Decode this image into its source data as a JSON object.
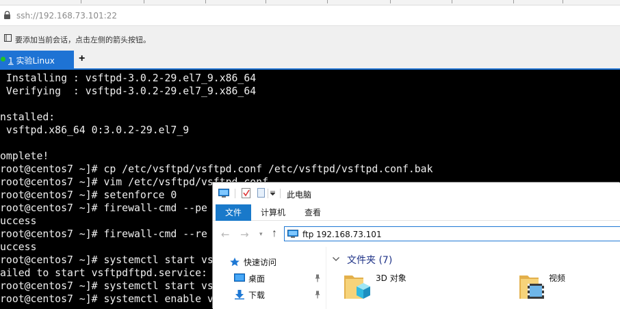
{
  "address_bar": {
    "url": "ssh://192.168.73.101:22"
  },
  "hint_bar": {
    "text": "要添加当前会话，点击左侧的箭头按钮。"
  },
  "tabs": [
    {
      "number": "1",
      "label": "实验Linux"
    }
  ],
  "new_tab_label": "+",
  "terminal": {
    "lines": [
      " Installing : vsftpd-3.0.2-29.el7_9.x86_64",
      " Verifying  : vsftpd-3.0.2-29.el7_9.x86_64",
      "",
      "nstalled:",
      " vsftpd.x86_64 0:3.0.2-29.el7_9",
      "",
      "omplete!",
      "root@centos7 ~]# cp /etc/vsftpd/vsftpd.conf /etc/vsftpd/vsftpd.conf.bak",
      "root@centos7 ~]# vim /etc/vsftpd/vsftpd.conf",
      "root@centos7 ~]# setenforce 0",
      "root@centos7 ~]# firewall-cmd --pe",
      "uccess",
      "root@centos7 ~]# firewall-cmd --re",
      "uccess",
      "root@centos7 ~]# systemctl start vs",
      "ailed to start vsftpdftpd.service:",
      "root@centos7 ~]# systemctl start vs",
      "root@centos7 ~]# systemctl enable v"
    ]
  },
  "explorer": {
    "title": "此电脑",
    "ribbon_tabs": [
      "文件",
      "计算机",
      "查看"
    ],
    "address": "ftp 192.168.73.101",
    "nav_items": [
      {
        "label": "快速访问",
        "icon": "star-icon",
        "pinned": false
      },
      {
        "label": "桌面",
        "icon": "desktop-icon",
        "pinned": true
      },
      {
        "label": "下载",
        "icon": "download-icon",
        "pinned": true
      }
    ],
    "group_header": "文件夹 (7)",
    "folders": [
      {
        "label": "3D 对象",
        "icon": "3d-objects-folder-icon"
      },
      {
        "label": "视频",
        "icon": "videos-folder-icon"
      }
    ]
  },
  "colors": {
    "tab_active": "#1e73d4",
    "status_dot": "#23c427",
    "ribbon_file": "#1979ca",
    "group_header": "#1e3287",
    "terminal_bg": "#000000",
    "terminal_fg": "#f0f0f0"
  }
}
